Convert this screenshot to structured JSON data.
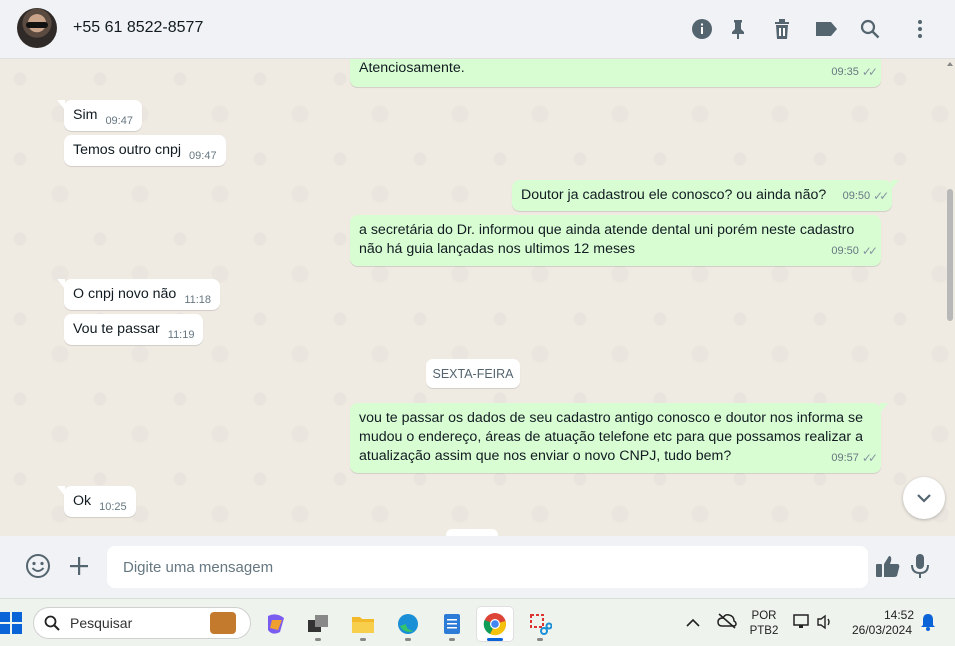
{
  "header": {
    "contact_name": "+55 61 8522-8577",
    "icons": [
      "info-icon",
      "pin-icon",
      "trash-icon",
      "label-icon",
      "search-icon",
      "more-icon"
    ]
  },
  "messages": [
    {
      "dir": "out",
      "text": "Atenciosamente.",
      "time": "09:35",
      "status": "read"
    },
    {
      "dir": "in",
      "text": "Sim",
      "time": "09:47"
    },
    {
      "dir": "in",
      "text": "Temos outro cnpj",
      "time": "09:47"
    },
    {
      "dir": "out",
      "text": "Doutor ja cadastrou ele conosco? ou ainda não?",
      "time": "09:50",
      "status": "read"
    },
    {
      "dir": "out",
      "text": "a secretária do Dr. informou que ainda atende dental uni porém neste cadastro não há guia lançadas nos ultimos 12 meses",
      "time": "09:50",
      "status": "read"
    },
    {
      "dir": "in",
      "text": "O cnpj novo não",
      "time": "11:18"
    },
    {
      "dir": "in",
      "text": "Vou te passar",
      "time": "11:19"
    },
    {
      "dir": "out",
      "text": "vou te passar os dados de seu cadastro antigo conosco e doutor nos informa se mudou o endereço, áreas de atuação telefone etc para que possamos realizar a atualização assim que nos enviar o novo CNPJ, tudo bem?",
      "time": "09:57",
      "status": "read"
    },
    {
      "dir": "in",
      "text": "Ok",
      "time": "10:25"
    }
  ],
  "day_separator": "SEXTA-FEIRA",
  "composer": {
    "placeholder": "Digite uma mensagem"
  },
  "taskbar": {
    "search_label": "Pesquisar",
    "lang_top": "POR",
    "lang_bottom": "PTB2",
    "time": "14:52",
    "date": "26/03/2024"
  }
}
